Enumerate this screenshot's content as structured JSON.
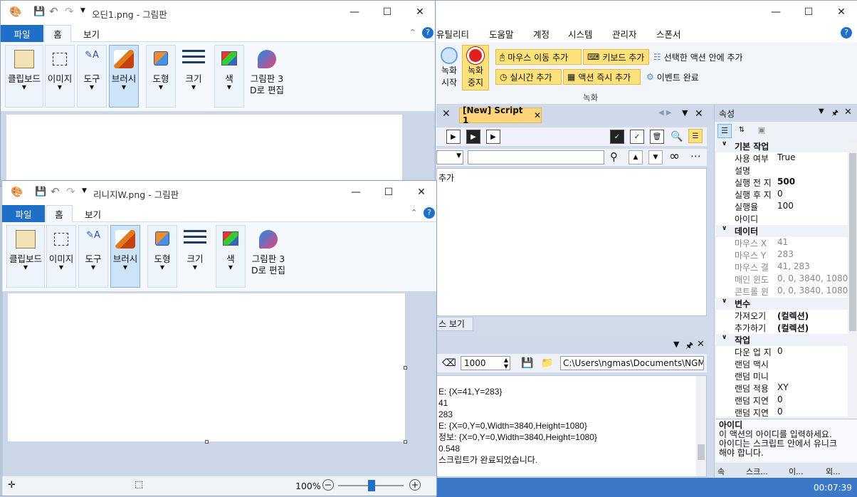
{
  "back_app": {
    "menu": [
      "유틸리티",
      "도움말",
      "계정",
      "시스템",
      "관리자",
      "스폰서"
    ],
    "record": {
      "start_label_1": "녹화",
      "start_label_2": "시작",
      "stop_label_1": "녹화",
      "stop_label_2": "중지",
      "add_mouse": "마우스 이동 추가",
      "add_keyboard": "키보드 추가",
      "add_in_selected": "선택한 액션 안에 추가",
      "add_realtime": "실시간 추가",
      "add_action_now": "액션 즉시 추가",
      "event_done": "이벤트 완료",
      "group_label": "녹화"
    },
    "script_tab": "[New] Script 1",
    "editor_text": "추가",
    "source_tab": "스 보기",
    "output": {
      "interval": "1000",
      "path": "C:\\Users\\ngmas\\Documents\\NGM6\\",
      "lines": [
        "E: {X=41,Y=283}",
        "41",
        "283",
        "E: {X=0,Y=0,Width=3840,Height=1080}",
        "정보: {X=0,Y=0,Width=3840,Height=1080}",
        "0.548",
        "스크립트가 완료되었습니다."
      ]
    },
    "status_time": "00:07:39",
    "props": {
      "title": "속성",
      "rows": [
        {
          "type": "cat",
          "name": "기본 작업"
        },
        {
          "name": "사용 여부",
          "value": "True"
        },
        {
          "name": "설명",
          "value": ""
        },
        {
          "name": "실행 전 지",
          "value": "500"
        },
        {
          "name": "실행 후 지",
          "value": "0"
        },
        {
          "name": "실행율",
          "value": "100"
        },
        {
          "name": "아이디",
          "value": ""
        },
        {
          "type": "cat",
          "name": "데이터"
        },
        {
          "name": "마우스 X",
          "value": "41"
        },
        {
          "name": "마우스 Y",
          "value": "283"
        },
        {
          "name": "마우스 결",
          "value": "41, 283"
        },
        {
          "name": "매인 윈도",
          "value": "0, 0, 3840, 1080"
        },
        {
          "name": "콘트롤 윈",
          "value": "0, 0, 3840, 1080"
        },
        {
          "type": "cat",
          "name": "변수"
        },
        {
          "name": "가져오기",
          "value": "(컬렉션)"
        },
        {
          "name": "추가하기",
          "value": "(컬렉션)"
        },
        {
          "type": "cat",
          "name": "작업"
        },
        {
          "name": "다운 업 지",
          "value": "0"
        },
        {
          "name": "랜덤 맥시",
          "value": ""
        },
        {
          "name": "랜덤 미니",
          "value": ""
        },
        {
          "name": "랜덤 적용",
          "value": "XY"
        },
        {
          "name": "랜덤 지연",
          "value": "0"
        },
        {
          "name": "랜덤 지연",
          "value": "0"
        }
      ],
      "desc_title": "아이디",
      "desc_line1": "이 액션의 아이디를 입력하세요.",
      "desc_line2": "아이디는 스크립트 안에서 유니크",
      "desc_line3": "해야 합니다.",
      "tabs": [
        "속",
        "스크...",
        "이...",
        "외..."
      ]
    }
  },
  "paint1": {
    "title": "오딘1.png - 그림판",
    "tab_file": "파일",
    "tab_home": "홈",
    "tab_view": "보기"
  },
  "paint2": {
    "title": "리니지W.png - 그림판",
    "tab_file": "파일",
    "tab_home": "홈",
    "tab_view": "보기",
    "zoom": "100%"
  },
  "ribbon_groups": [
    {
      "label": "클립보드",
      "icon": "clipboard-icon"
    },
    {
      "label": "이미지",
      "icon": "select-icon"
    },
    {
      "label": "도구",
      "icon": "tools-icon"
    },
    {
      "label": "브러시",
      "icon": "brush-icon"
    },
    {
      "label": "도형",
      "icon": "shapes-icon"
    },
    {
      "label": "크기",
      "icon": "size-icon"
    },
    {
      "label": "색",
      "icon": "color-icon"
    },
    {
      "label1": "그림판 3",
      "label2": "D로 편집",
      "icon": "paint3d-icon"
    }
  ]
}
